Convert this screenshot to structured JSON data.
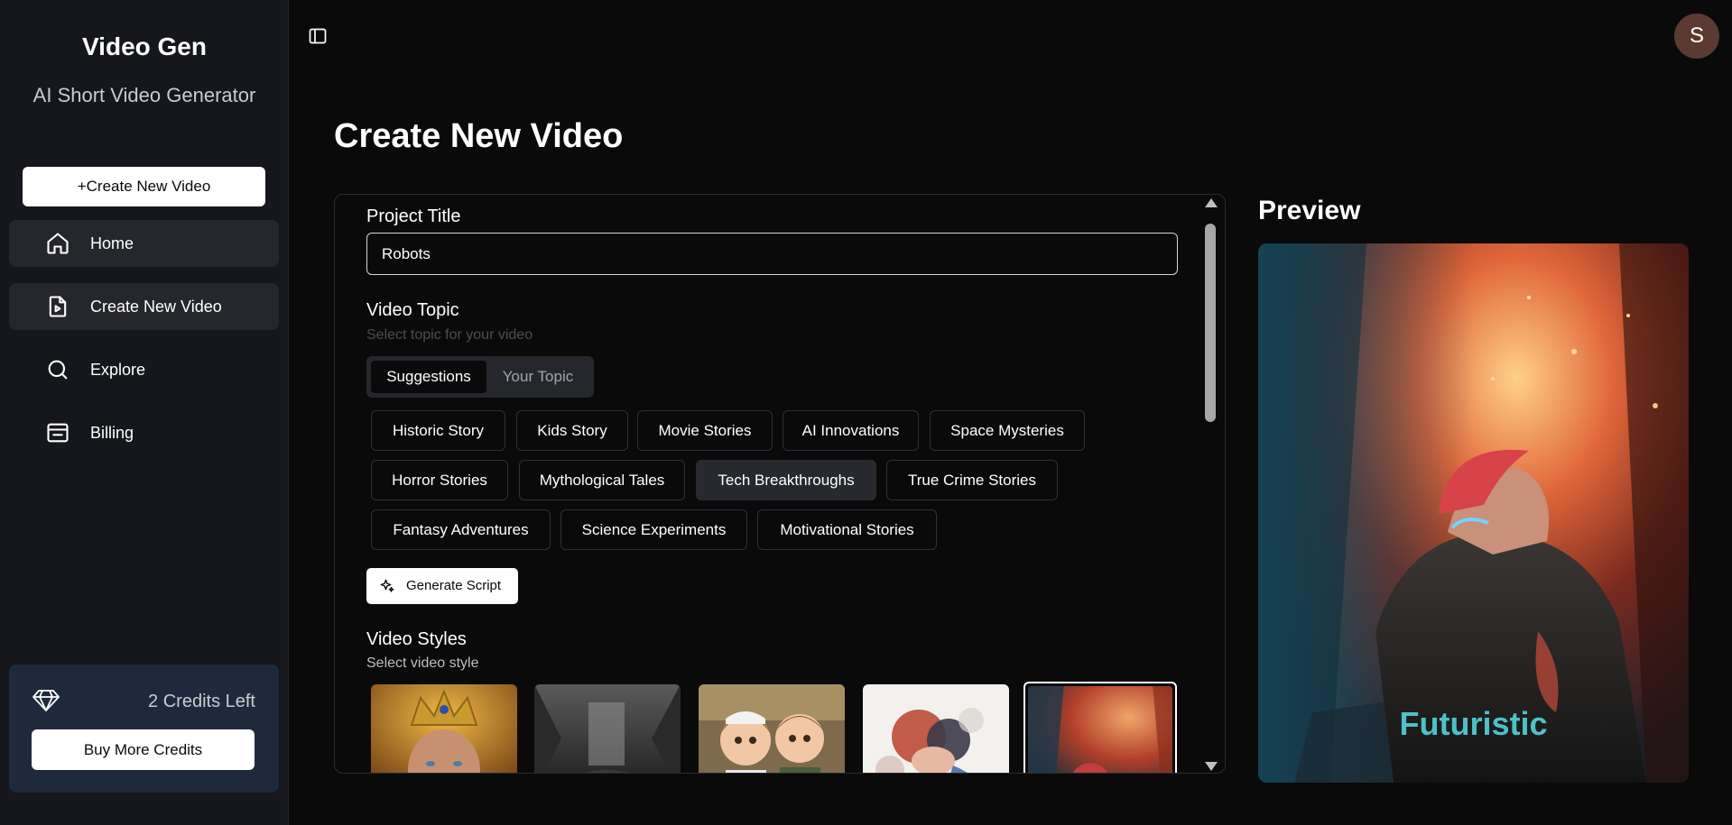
{
  "brand": {
    "title": "Video Gen",
    "subtitle": "AI Short Video Generator"
  },
  "sidebar": {
    "create_button": "+Create New Video",
    "items": [
      {
        "label": "Home",
        "icon": "home-icon",
        "active": true
      },
      {
        "label": "Create New Video",
        "icon": "file-video-icon",
        "active": true
      },
      {
        "label": "Explore",
        "icon": "search-icon",
        "active": false
      },
      {
        "label": "Billing",
        "icon": "wallet-icon",
        "active": false
      }
    ],
    "credits": {
      "text": "2 Credits Left",
      "button": "Buy More Credits",
      "icon": "gem-icon"
    }
  },
  "header": {
    "avatar_initial": "S"
  },
  "page": {
    "title": "Create New Video"
  },
  "form": {
    "project_title_label": "Project Title",
    "project_title_value": "Robots",
    "video_topic_label": "Video Topic",
    "video_topic_hint": "Select topic for your video",
    "tabs": [
      {
        "label": "Suggestions",
        "active": true
      },
      {
        "label": "Your Topic",
        "active": false
      }
    ],
    "topics": [
      "Historic Story",
      "Kids Story",
      "Movie Stories",
      "AI Innovations",
      "Space Mysteries",
      "Horror Stories",
      "Mythological Tales",
      "Tech Breakthroughs",
      "True Crime Stories",
      "Fantasy Adventures",
      "Science Experiments",
      "Motivational Stories"
    ],
    "selected_topic": "Tech Breakthroughs",
    "generate_button": "Generate Script",
    "video_styles_label": "Video Styles",
    "video_styles_hint": "Select video style"
  },
  "preview": {
    "title": "Preview",
    "caption": "Futuristic"
  },
  "colors": {
    "accent_caption": "#4fc0c8",
    "sidebar_bg": "#15171c",
    "credits_bg": "#1e2a3c"
  }
}
